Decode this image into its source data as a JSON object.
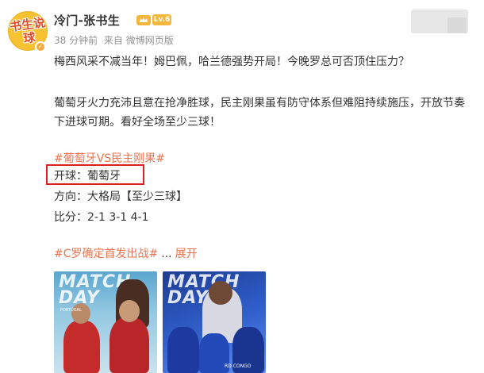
{
  "author": {
    "name": "冷门-张书生",
    "avatar_text": "书生说球",
    "level": "Lv.6",
    "time": "38 分钟前",
    "source": "来自 微博网页版"
  },
  "post": {
    "paragraph1": "梅西风采不减当年！姆巴佩，哈兰德强势开局！今晚罗总可否顶住压力？",
    "paragraph2": "葡萄牙火力充沛且意在抢净胜球，民主刚果虽有防守体系但难阻持续施压，开放节奏下进球可期。看好全场至少三球！",
    "topic": "#葡萄牙VS民主刚果#",
    "kickoff": "开球：葡萄牙",
    "direction": "方向：大格局【至少三球】",
    "score": "比分：2-1 3-1 4-1",
    "hashtag": "#C罗确定首发出战#",
    "ellipsis": "...",
    "expand": "展开"
  },
  "images": [
    {
      "title": "MATCH DAY",
      "caption": "PORTUGAL"
    },
    {
      "title": "MATCH DAY",
      "caption": "RD CONGO"
    }
  ],
  "colors": {
    "link": "#eb7350",
    "highlight_box": "#e01c24",
    "meta": "#939393"
  }
}
